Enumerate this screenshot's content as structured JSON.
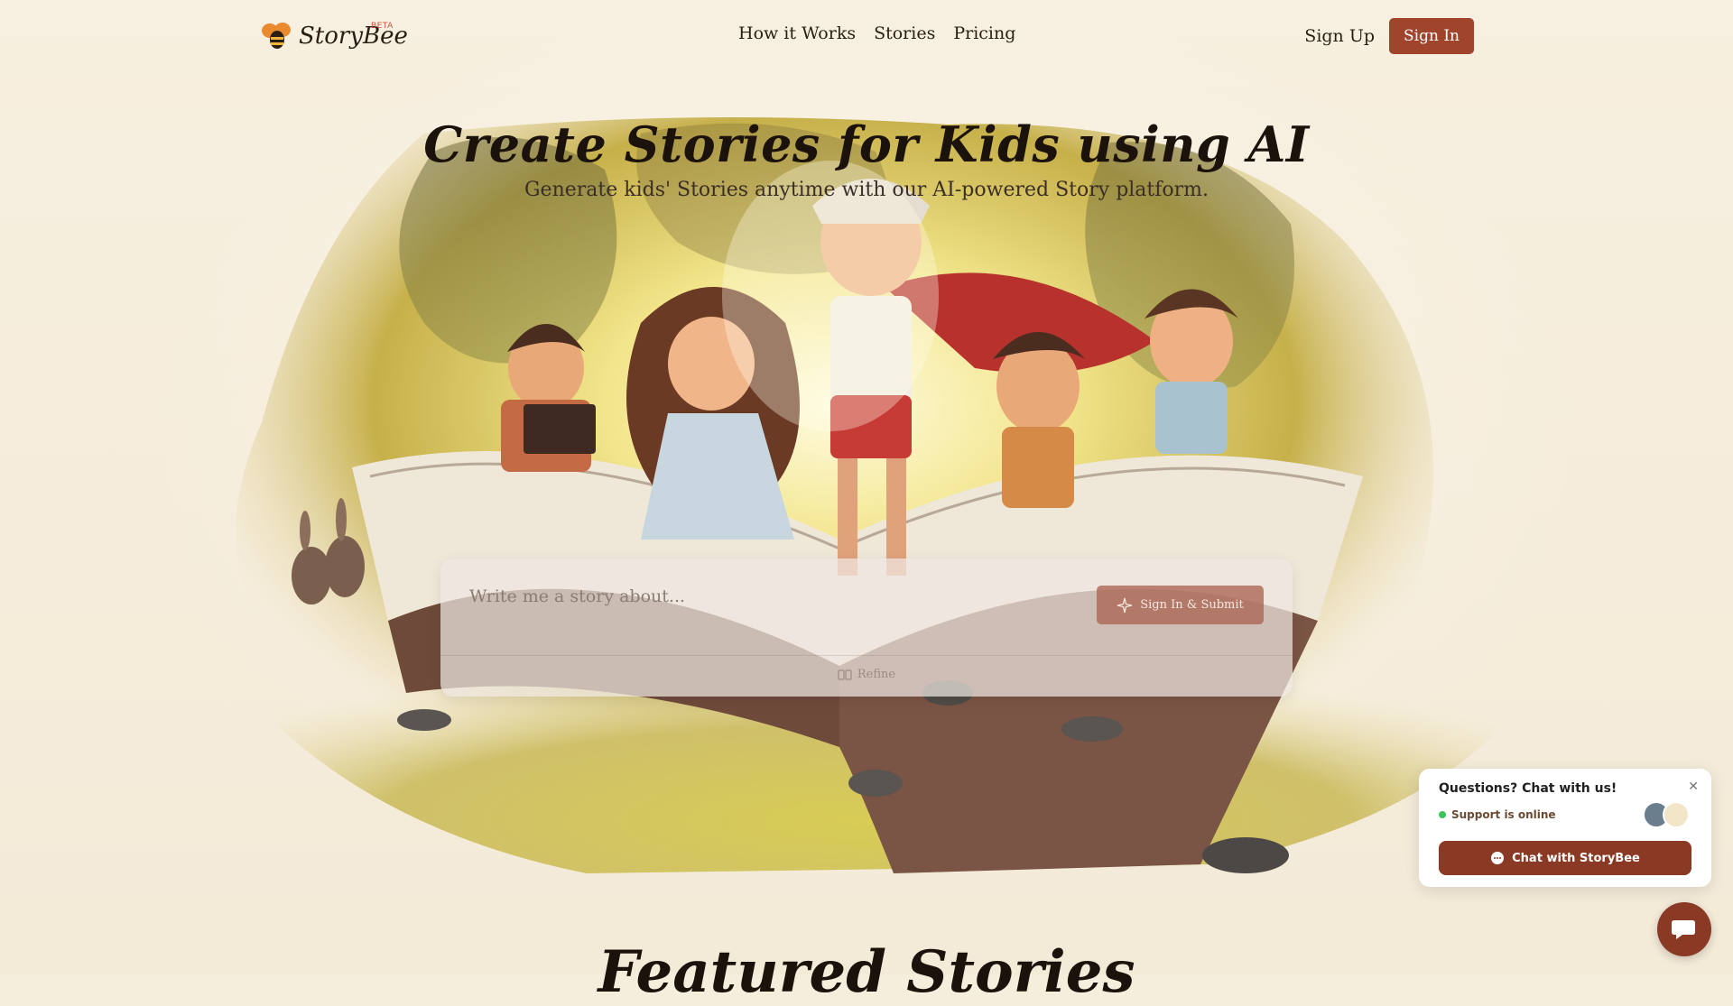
{
  "header": {
    "brand": "StoryBee",
    "badge": "BETA",
    "nav": [
      "How it Works",
      "Stories",
      "Pricing"
    ],
    "sign_up": "Sign Up",
    "sign_in": "Sign In"
  },
  "hero": {
    "title": "Create Stories for Kids using AI",
    "subtitle": "Generate kids' Stories anytime with our AI-powered Story platform."
  },
  "prompt": {
    "placeholder": "Write me a story about...",
    "submit_label": "Sign In & Submit",
    "refine_label": "Refine"
  },
  "featured": {
    "title": "Featured Stories"
  },
  "chat": {
    "title": "Questions? Chat with us!",
    "status": "Support is online",
    "button_label": "Chat with StoryBee"
  },
  "colors": {
    "accent": "#a0452c",
    "chat_accent": "#8a3a24",
    "background": "#f6eedd"
  }
}
